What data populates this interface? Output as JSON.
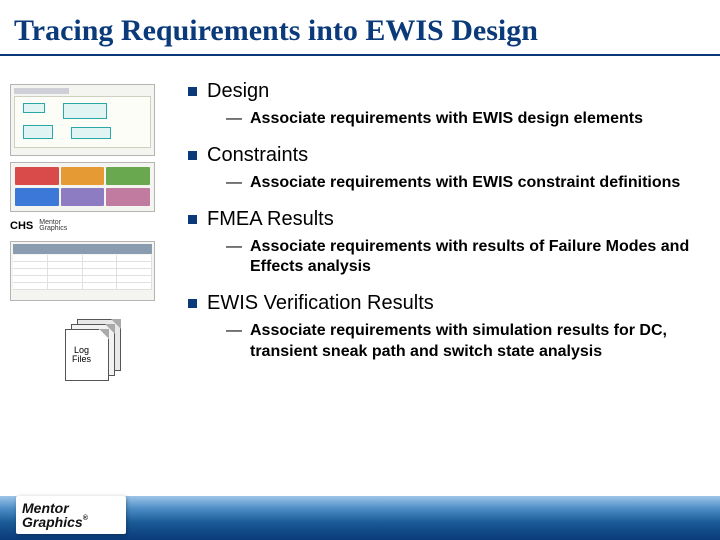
{
  "title": "Tracing Requirements into EWIS Design",
  "sections": [
    {
      "heading": "Design",
      "sub": "Associate requirements with EWIS design elements"
    },
    {
      "heading": "Constraints",
      "sub": "Associate requirements with EWIS constraint definitions"
    },
    {
      "heading": "FMEA Results",
      "sub": "Associate requirements with results of Failure Modes and Effects analysis"
    },
    {
      "heading": "EWIS Verification Results",
      "sub": "Associate requirements with simulation results for DC, transient sneak path and switch state analysis"
    }
  ],
  "left": {
    "chs_label": "CHS",
    "mentor_tiny": "Mentor\nGraphics",
    "log_label": "Log\nFiles"
  },
  "footer": {
    "logo_top": "Mentor",
    "logo_bot": "Graphics",
    "reg": "®"
  },
  "swatch_colors": [
    "#d94a4a",
    "#e69a33",
    "#6aa84f",
    "#3c78d8",
    "#8e7cc3",
    "#c27ba0"
  ]
}
